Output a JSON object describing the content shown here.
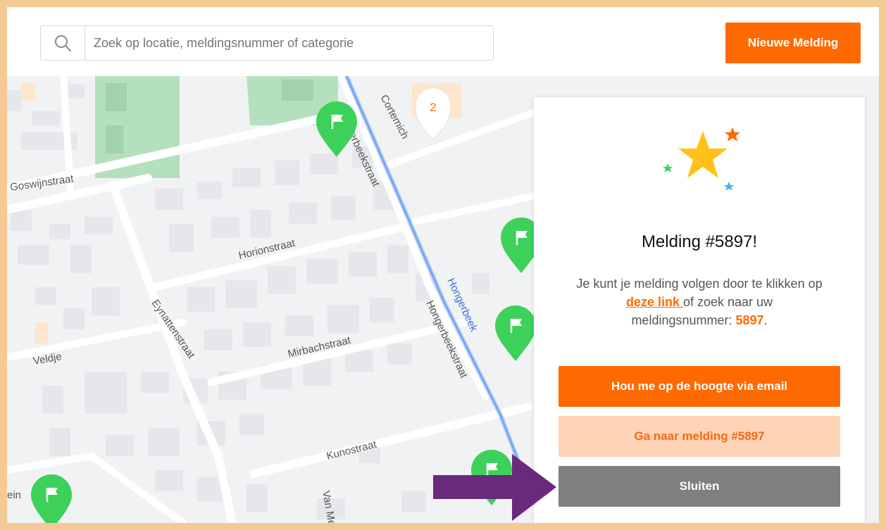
{
  "search": {
    "placeholder": "Zoek op locatie, meldingsnummer of categorie",
    "icon": "search-icon"
  },
  "header": {
    "new_report_label": "Nieuwe Melding"
  },
  "map": {
    "streets": {
      "goswijnstraat": "Goswijnstraat",
      "horionstraat": "Horionstraat",
      "mirbachstraat": "Mirbachstraat",
      "eynattenstraat": "Eynattenstraat",
      "veldje": "Veldje",
      "hongerbeekstraat_1": "Hongerbeekstraat",
      "hongerbeekstraat_2": "Hongerbeekstraat",
      "kunostraat": "Kunostraat",
      "cortemich": "Cortemich",
      "van_me": "Van Me",
      "ein": "ein"
    },
    "water": {
      "hongerbeek": "Hongerbeek"
    },
    "cluster_count": "2",
    "marker_icon": "flag-marker-icon"
  },
  "panel": {
    "title": "Melding #5897!",
    "text_before_link": "Je kunt je melding volgen door te klikken op ",
    "link_text": "deze link ",
    "text_after_link": "of zoek naar uw meldingsnummer: ",
    "report_number": "5897",
    "text_end": ".",
    "email_button": "Hou me op de hoogte via email",
    "goto_button": "Ga naar melding #5897",
    "close_button": "Sluiten"
  },
  "colors": {
    "accent": "#ff6a00",
    "accent_light": "#ffd3b5",
    "close_gray": "#7f7f7f",
    "marker_green": "#3dd15a",
    "frame": "#f5c994",
    "arrow_purple": "#6a2a7b"
  }
}
